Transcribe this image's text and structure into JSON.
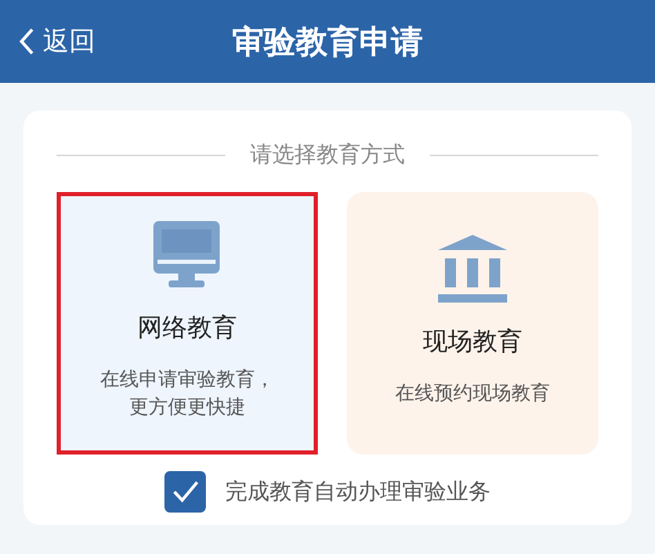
{
  "header": {
    "back": "返回",
    "title": "审验教育申请"
  },
  "section_title": "请选择教育方式",
  "options": [
    {
      "kind": "online",
      "title": "网络教育",
      "desc_lines": [
        "在线申请审验教育，",
        "更方便更快捷"
      ],
      "selected": true
    },
    {
      "kind": "onsite",
      "title": "现场教育",
      "desc_lines": [
        "在线预约现场教育"
      ],
      "selected": false
    }
  ],
  "auto_process": {
    "label": "完成教育自动办理审验业务",
    "checked": true
  }
}
